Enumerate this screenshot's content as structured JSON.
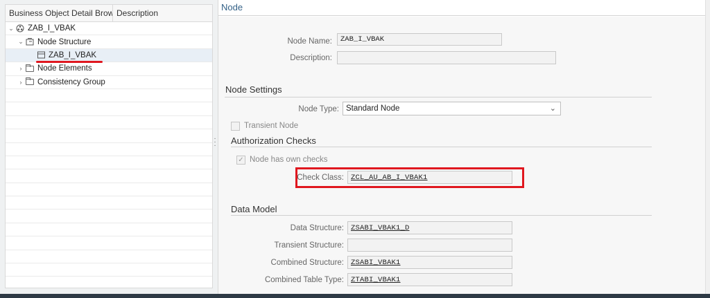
{
  "tree": {
    "columns": [
      "Business Object Detail Brow...",
      "Description"
    ],
    "items": [
      {
        "label": "ZAB_I_VBAK",
        "icon": "business-object-icon",
        "expanded": true
      },
      {
        "label": "Node Structure",
        "icon": "node-structure-icon",
        "expanded": true
      },
      {
        "label": "ZAB_I_VBAK",
        "icon": "node-icon",
        "selected": true
      },
      {
        "label": "Node Elements",
        "icon": "folder-icon",
        "expanded": false
      },
      {
        "label": "Consistency Group",
        "icon": "folder-icon",
        "expanded": false
      }
    ],
    "empty_rows": 14
  },
  "detail": {
    "title": "Node",
    "node_name_label": "Node Name:",
    "node_name": "ZAB_I_VBAK",
    "description_label": "Description:",
    "description": "",
    "settings_title": "Node Settings",
    "node_type_label": "Node Type:",
    "node_type": "Standard Node",
    "transient_node_label": "Transient Node",
    "transient_node_checked": false,
    "auth_title": "Authorization Checks",
    "own_checks_label": "Node has own checks",
    "own_checks_checked": true,
    "check_class_label": "Check Class:",
    "check_class": "ZCL_AU_AB_I_VBAK1",
    "data_model_title": "Data Model",
    "data_structure_label": "Data Structure:",
    "data_structure": "ZSABI_VBAK1_D",
    "transient_structure_label": "Transient Structure:",
    "transient_structure": "",
    "combined_structure_label": "Combined Structure:",
    "combined_structure": "ZSABI_VBAK1",
    "combined_table_type_label": "Combined Table Type:",
    "combined_table_type": "ZTABI_VBAK1"
  },
  "colors": {
    "highlight": "#e0171f",
    "title": "#346187",
    "selected_row": "#e8eff6"
  }
}
